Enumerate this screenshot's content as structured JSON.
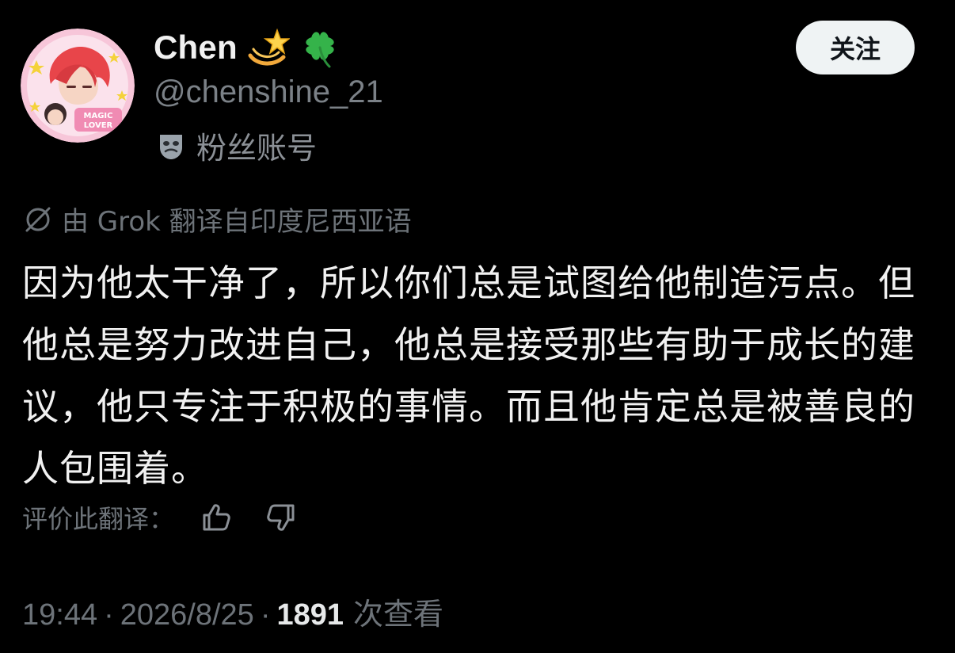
{
  "author": {
    "display_name": "Chen",
    "handle": "@chenshine_21",
    "emoji_icons": [
      "dizzy-star-icon",
      "four-leaf-clover-icon"
    ],
    "badge_label": "粉丝账号",
    "badge_icon": "theater-mask-icon",
    "avatar_text": [
      "MAGIC",
      "LOVER"
    ]
  },
  "follow_button": {
    "label": "关注"
  },
  "translation": {
    "notice": "由 Grok 翻译自印度尼西亚语",
    "icon": "translate-circle-slash-icon"
  },
  "tweet": {
    "text": "因为他太干净了，所以你们总是试图给他制造污点。但他总是努力改进自己，他总是接受那些有助于成长的建议，他只专注于积极的事情。而且他肯定总是被善良的人包围着。"
  },
  "rating": {
    "label": "评价此翻译：",
    "up_icon": "thumbs-up-icon",
    "down_icon": "thumbs-down-icon"
  },
  "meta": {
    "time": "19:44",
    "separator": "·",
    "date": "2026/8/25",
    "views_count": "1891",
    "views_label": "次查看"
  },
  "colors": {
    "background": "#000000",
    "primary_text": "#f1f1f1",
    "secondary_text": "#6d7379",
    "follow_bg": "#eff3f4"
  }
}
